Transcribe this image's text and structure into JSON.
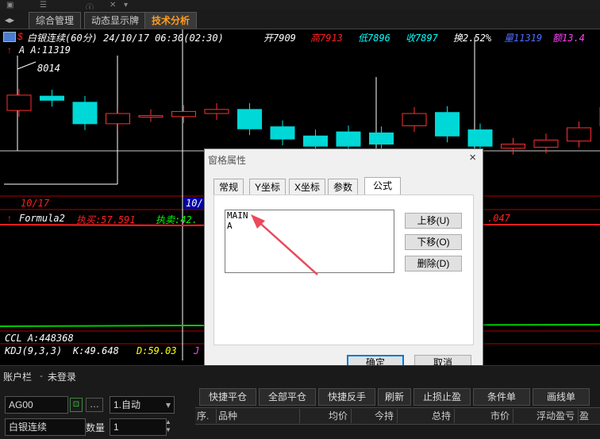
{
  "tabs": [
    {
      "label": "综合管理"
    },
    {
      "label": "动态显示牌"
    },
    {
      "label": "技术分析"
    }
  ],
  "chart": {
    "header": {
      "title": "白银连续(60分) 24/10/17 06:30(02:30)",
      "open": "开7909",
      "high": "高7913",
      "low": "低7896",
      "close": "收7897",
      "change": "换2.52%",
      "vol": "量11319",
      "amount": "额13.4"
    },
    "main_indicator": "A A:11319",
    "high_mark": "8014",
    "date_left": "10/17",
    "date_right": "10/",
    "sub1": {
      "name": "Formula2",
      "buy": "执买:57.591",
      "sell": "执卖:42.",
      "tail": ".047"
    },
    "sub2": "CCL A:448368",
    "sub3": {
      "name": "KDJ(9,3,3)",
      "k": "K:49.648",
      "d": "D:59.03",
      "j": "J"
    },
    "candles": [
      {
        "o": 7895,
        "c": 7910
      },
      {
        "o": 7909,
        "c": 7905
      },
      {
        "o": 7903,
        "c": 7882
      },
      {
        "o": 7882,
        "c": 7892
      },
      {
        "o": 7890,
        "c": 7890
      },
      {
        "o": 7889,
        "c": 7894
      },
      {
        "o": 7892,
        "c": 7896
      },
      {
        "o": 7896,
        "c": 7877
      },
      {
        "o": 7879,
        "c": 7867
      },
      {
        "o": 7870,
        "c": 7860
      },
      {
        "o": 7874,
        "c": 7860
      },
      {
        "o": 7873,
        "c": 7862
      },
      {
        "o": 7880,
        "c": 7892
      },
      {
        "o": 7893,
        "c": 7870
      },
      {
        "o": 7876,
        "c": 7860
      },
      {
        "o": 7858,
        "c": 7862
      },
      {
        "o": 7859,
        "c": 7866
      },
      {
        "o": 7865,
        "c": 7878
      },
      {
        "o": 7880,
        "c": 7898
      }
    ]
  },
  "dialog": {
    "title": "窗格属性",
    "close": "×",
    "tabs": [
      "常规",
      "Y坐标",
      "X坐标",
      "参数",
      "公式"
    ],
    "active_tab": 4,
    "list": [
      "MAIN",
      "A"
    ],
    "buttons": {
      "up": "上移(U)",
      "down": "下移(O)",
      "delete": "删除(D)",
      "ok": "确定",
      "cancel": "取消"
    }
  },
  "account": {
    "label": "账户栏",
    "status": "未登录",
    "code": "AG00",
    "product": "白银连续",
    "mode": "1.自动",
    "qty_label": "数量",
    "qty": "1",
    "actions": [
      "快捷平仓",
      "全部平仓",
      "快捷反手",
      "刷新",
      "止损止盈",
      "条件单",
      "画线单"
    ],
    "columns": [
      "序.",
      "品种",
      "均价",
      "今持",
      "总持",
      "市价",
      "浮动盈亏",
      "盈"
    ]
  }
}
